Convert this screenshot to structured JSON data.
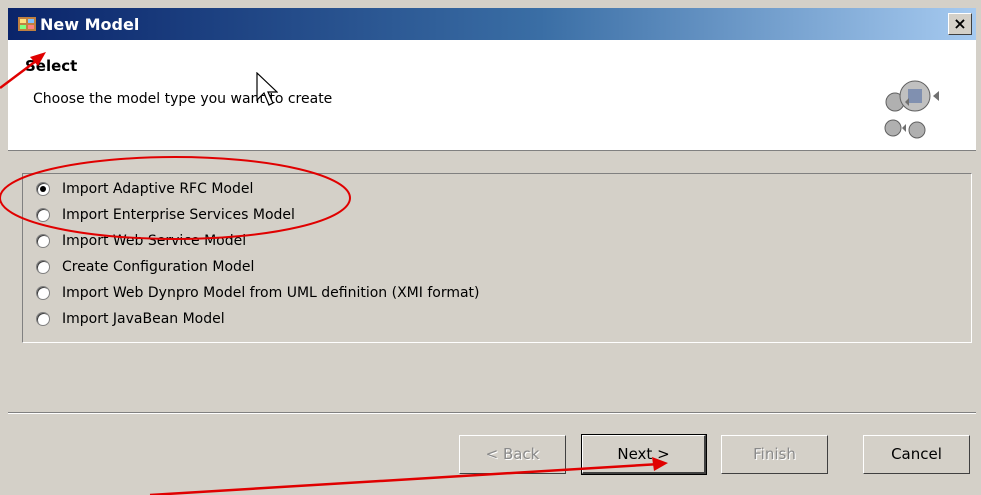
{
  "dialog": {
    "title": "New Model",
    "close_glyph": "×",
    "icons": [
      "app-icon",
      "close-icon",
      "wizard-graphic-icon",
      "mouse-pointer-icon"
    ]
  },
  "header": {
    "title": "Select",
    "description": "Choose the model type you want to create"
  },
  "options": [
    {
      "label": "Import Adaptive RFC Model",
      "selected": true
    },
    {
      "label": "Import Enterprise Services Model",
      "selected": false
    },
    {
      "label": "Import Web Service Model",
      "selected": false
    },
    {
      "label": "Create Configuration Model",
      "selected": false
    },
    {
      "label": "Import Web Dynpro Model from UML definition (XMI format)",
      "selected": false
    },
    {
      "label": "Import JavaBean Model",
      "selected": false
    }
  ],
  "buttons": {
    "back": "< Back",
    "next": "Next >",
    "finish": "Finish",
    "cancel": "Cancel"
  },
  "colors": {
    "title_gradient_start": "#0a246a",
    "title_gradient_end": "#a6caf0",
    "dialog_bg": "#d4d0c8",
    "annotation_red": "#e00000"
  }
}
